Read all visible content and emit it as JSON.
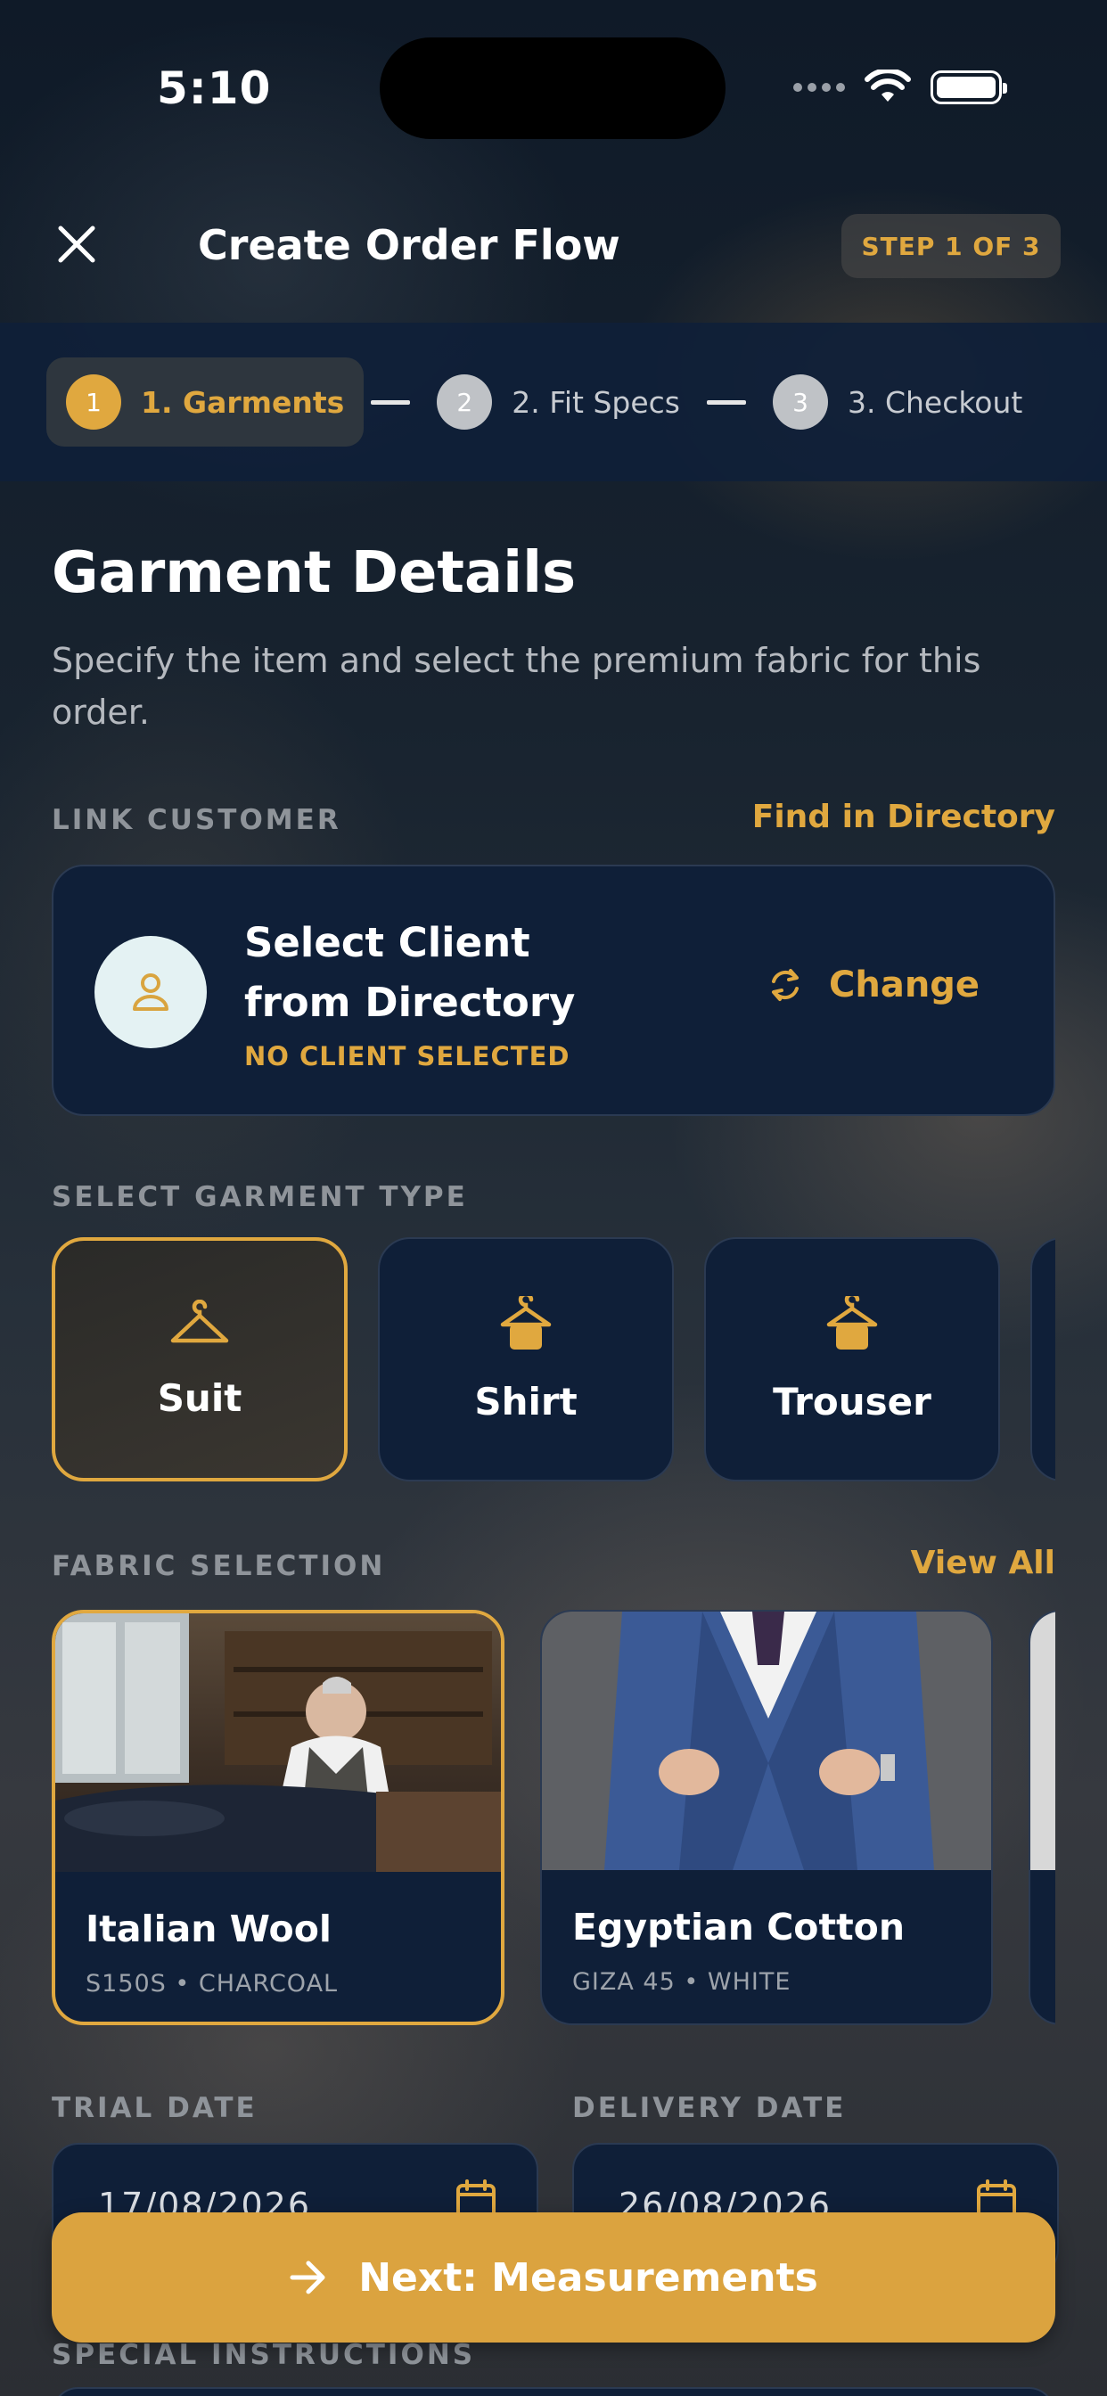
{
  "status_bar": {
    "time": "5:10"
  },
  "header": {
    "title": "Create Order Flow",
    "step_badge": "STEP 1 OF 3"
  },
  "stepper": {
    "steps": [
      {
        "num": "1",
        "label": "1. Garments",
        "active": true
      },
      {
        "num": "2",
        "label": "2. Fit Specs",
        "active": false
      },
      {
        "num": "3",
        "label": "3. Checkout",
        "active": false
      }
    ]
  },
  "main": {
    "title": "Garment Details",
    "subtitle": "Specify the item and select the premium fabric for this order."
  },
  "customer": {
    "section_label": "LINK CUSTOMER",
    "find_link": "Find in Directory",
    "name": "Select Client from Directory",
    "status": "NO CLIENT SELECTED",
    "change_label": "Change"
  },
  "garment": {
    "section_label": "SELECT GARMENT TYPE",
    "types": [
      {
        "label": "Suit",
        "selected": true
      },
      {
        "label": "Shirt",
        "selected": false
      },
      {
        "label": "Trouser",
        "selected": false
      }
    ]
  },
  "fabric": {
    "section_label": "FABRIC SELECTION",
    "view_all": "View All",
    "items": [
      {
        "name": "Italian Wool",
        "meta": "S150S • CHARCOAL",
        "selected": true
      },
      {
        "name": "Egyptian Cotton",
        "meta": "GIZA 45 • WHITE",
        "selected": false
      }
    ]
  },
  "dates": {
    "trial_label": "TRIAL DATE",
    "trial_value": "17/08/2026",
    "delivery_label": "DELIVERY DATE",
    "delivery_value": "26/08/2026"
  },
  "special": {
    "label": "SPECIAL INSTRUCTIONS"
  },
  "actions": {
    "next_label": "Next: Measurements"
  },
  "colors": {
    "accent": "#E0A83F",
    "card": "#0F1F38",
    "background": "#0E1826"
  }
}
